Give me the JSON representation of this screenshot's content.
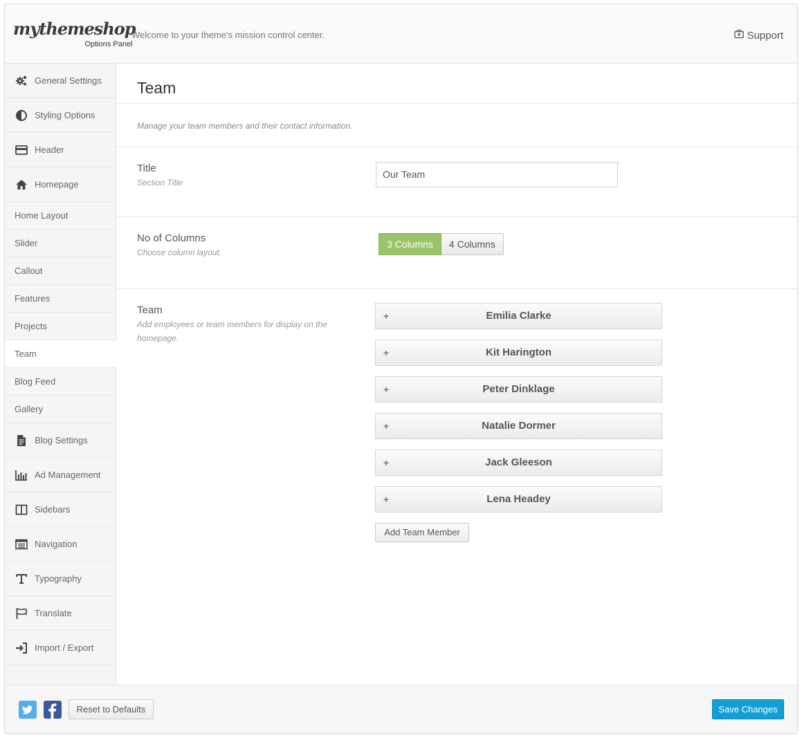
{
  "header": {
    "logo_text": "mythemeshop",
    "logo_subtitle": "Options Panel",
    "welcome": "Welcome to your theme's mission control center.",
    "support_label": "Support"
  },
  "sidebar": {
    "items": [
      {
        "label": "General Settings",
        "icon": "gears-icon"
      },
      {
        "label": "Styling Options",
        "icon": "contrast-icon"
      },
      {
        "label": "Header",
        "icon": "card-icon"
      },
      {
        "label": "Homepage",
        "icon": "home-icon"
      },
      {
        "label": "Home Layout"
      },
      {
        "label": "Slider"
      },
      {
        "label": "Callout"
      },
      {
        "label": "Features"
      },
      {
        "label": "Projects"
      },
      {
        "label": "Team",
        "active": true
      },
      {
        "label": "Blog Feed"
      },
      {
        "label": "Gallery"
      },
      {
        "label": "Blog Settings",
        "icon": "document-icon"
      },
      {
        "label": "Ad Management",
        "icon": "bar-chart-icon"
      },
      {
        "label": "Sidebars",
        "icon": "columns-icon"
      },
      {
        "label": "Navigation",
        "icon": "list-icon"
      },
      {
        "label": "Typography",
        "icon": "text-icon"
      },
      {
        "label": "Translate",
        "icon": "flag-icon"
      },
      {
        "label": "Import / Export",
        "icon": "sign-in-icon"
      }
    ]
  },
  "main": {
    "title": "Team",
    "description": "Manage your team members and their contact information.",
    "title_field": {
      "label": "Title",
      "help": "Section Title",
      "value": "Our Team"
    },
    "columns_field": {
      "label": "No of Columns",
      "help": "Choose column layout.",
      "options": [
        "3 Columns",
        "4 Columns"
      ],
      "selected": "3 Columns"
    },
    "team_field": {
      "label": "Team",
      "help": "Add employees or team members for display on the homepage.",
      "members": [
        "Emilia Clarke",
        "Kit Harington",
        "Peter Dinklage",
        "Natalie Dormer",
        "Jack Gleeson",
        "Lena Headey"
      ],
      "expand_symbol": "+",
      "add_label": "Add Team Member"
    }
  },
  "footer": {
    "reset_label": "Reset to Defaults",
    "save_label": "Save Changes"
  },
  "colors": {
    "accent_green": "#9cc26a",
    "save_blue": "#129fd6",
    "twitter_blue": "#55acee",
    "facebook_blue": "#3b5998"
  }
}
